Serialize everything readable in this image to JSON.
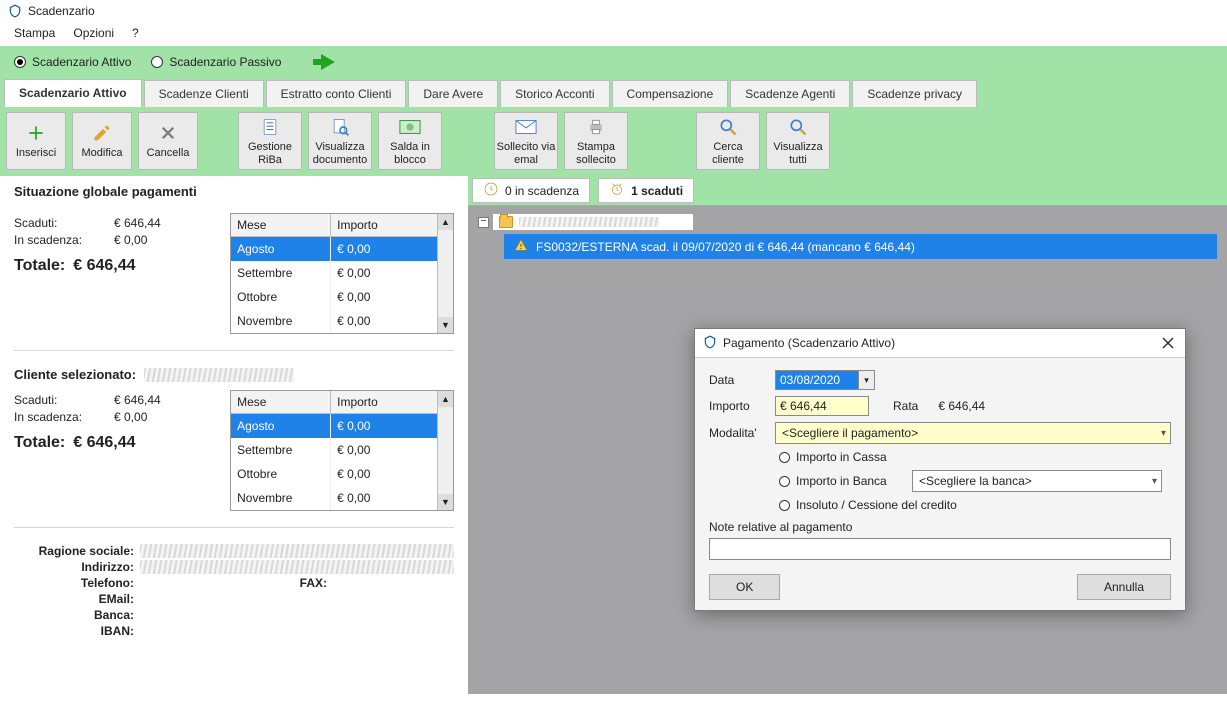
{
  "window": {
    "title": "Scadenzario"
  },
  "menu": {
    "stampa": "Stampa",
    "opzioni": "Opzioni",
    "help": "?"
  },
  "mode": {
    "attivo": "Scadenzario Attivo",
    "passivo": "Scadenzario Passivo",
    "selected": "attivo"
  },
  "tabs": [
    {
      "id": "attivo",
      "label": "Scadenzario Attivo",
      "active": true
    },
    {
      "id": "clienti",
      "label": "Scadenze Clienti"
    },
    {
      "id": "estratto",
      "label": "Estratto conto Clienti"
    },
    {
      "id": "dare",
      "label": "Dare Avere"
    },
    {
      "id": "storico",
      "label": "Storico Acconti"
    },
    {
      "id": "comp",
      "label": "Compensazione"
    },
    {
      "id": "agenti",
      "label": "Scadenze Agenti"
    },
    {
      "id": "privacy",
      "label": "Scadenze privacy"
    }
  ],
  "toolbar": {
    "inserisci": "Inserisci",
    "modifica": "Modifica",
    "cancella": "Cancella",
    "gestione_riba": "Gestione RiBa",
    "visualizza_doc": "Visualizza documento",
    "salda_blocco": "Salda in blocco",
    "sollecito_email": "Sollecito via emal",
    "stampa_sollecito": "Stampa sollecito",
    "cerca_cliente": "Cerca cliente",
    "visualizza_tutti": "Visualizza tutti"
  },
  "global": {
    "title": "Situazione globale pagamenti",
    "scaduti_k": "Scaduti:",
    "scaduti_v": "€ 646,44",
    "inscad_k": "In scadenza:",
    "inscad_v": "€ 0,00",
    "totale_k": "Totale:",
    "totale_v": "€ 646,44",
    "table": {
      "h_mese": "Mese",
      "h_importo": "Importo",
      "rows": [
        {
          "mese": "Agosto",
          "importo": "€ 0,00",
          "sel": true
        },
        {
          "mese": "Settembre",
          "importo": "€ 0,00"
        },
        {
          "mese": "Ottobre",
          "importo": "€ 0,00"
        },
        {
          "mese": "Novembre",
          "importo": "€ 0,00"
        }
      ]
    }
  },
  "cliente": {
    "title": "Cliente selezionato:",
    "scaduti_k": "Scaduti:",
    "scaduti_v": "€ 646,44",
    "inscad_k": "In scadenza:",
    "inscad_v": "€ 0,00",
    "totale_k": "Totale:",
    "totale_v": "€ 646,44",
    "table": {
      "h_mese": "Mese",
      "h_importo": "Importo",
      "rows": [
        {
          "mese": "Agosto",
          "importo": "€ 0,00",
          "sel": true
        },
        {
          "mese": "Settembre",
          "importo": "€ 0,00"
        },
        {
          "mese": "Ottobre",
          "importo": "€ 0,00"
        },
        {
          "mese": "Novembre",
          "importo": "€ 0,00"
        }
      ]
    }
  },
  "address": {
    "ragione": "Ragione sociale:",
    "indirizzo": "Indirizzo:",
    "telefono": "Telefono:",
    "fax": "FAX:",
    "email": "EMail:",
    "banca": "Banca:",
    "iban": "IBAN:"
  },
  "right": {
    "chip_inscad": "0 in scadenza",
    "chip_scaduti": "1 scaduti",
    "tree_item": "FS0032/ESTERNA scad. il 09/07/2020 di € 646,44 (mancano € 646,44)"
  },
  "dialog": {
    "title": "Pagamento (Scadenzario Attivo)",
    "data_lbl": "Data",
    "data_val": "03/08/2020",
    "importo_lbl": "Importo",
    "importo_val": "€ 646,44",
    "rata_lbl": "Rata",
    "rata_val": "€ 646,44",
    "modalita_lbl": "Modalita'",
    "modalita_placeholder": "<Scegliere il pagamento>",
    "r_cassa": "Importo in Cassa",
    "r_banca": "Importo in Banca",
    "banca_placeholder": "<Scegliere la banca>",
    "r_insoluto": "Insoluto / Cessione del credito",
    "note_lbl": "Note relative al pagamento",
    "ok": "OK",
    "annulla": "Annulla"
  }
}
